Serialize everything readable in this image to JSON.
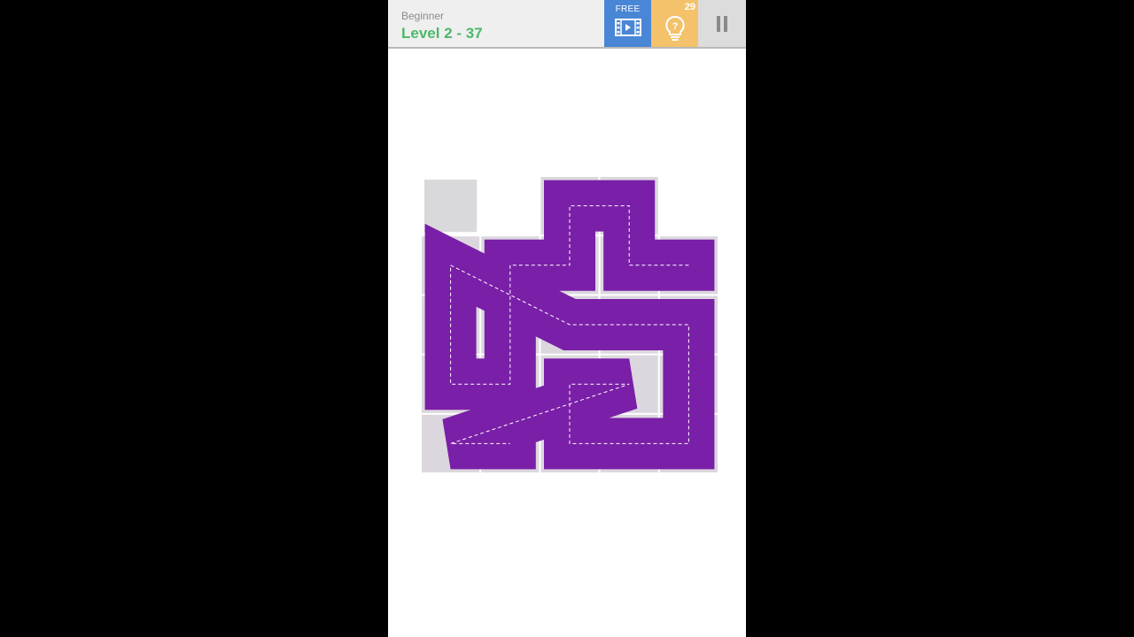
{
  "header": {
    "difficulty": "Beginner",
    "level": "Level 2 - 37",
    "free_label": "FREE",
    "hint_count": "29"
  },
  "icons": {
    "free": "film-icon",
    "hint": "lightbulb-question-icon",
    "pause": "pause-icon"
  },
  "colors": {
    "path": "#7a1fa8",
    "empty_cell": "#d9d9dc",
    "header_bg": "#efefef",
    "level_text": "#4cb869",
    "free_bg": "#4a86d6",
    "hint_bg": "#f3c26a",
    "pause_bg": "#dcdcdc"
  },
  "puzzle": {
    "rows": 5,
    "cols": 5,
    "empty_cells": [
      [
        0,
        0
      ]
    ],
    "path": [
      [
        1,
        4
      ],
      [
        1,
        3
      ],
      [
        0,
        3
      ],
      [
        0,
        2
      ],
      [
        1,
        2
      ],
      [
        1,
        1
      ],
      [
        2,
        1
      ],
      [
        3,
        1
      ],
      [
        3,
        0
      ],
      [
        2,
        0
      ],
      [
        1,
        0
      ],
      [
        2,
        2
      ],
      [
        2,
        3
      ],
      [
        2,
        4
      ],
      [
        3,
        4
      ],
      [
        4,
        4
      ],
      [
        4,
        3
      ],
      [
        4,
        2
      ],
      [
        3,
        2
      ],
      [
        3,
        3
      ],
      [
        4,
        0
      ],
      [
        4,
        1
      ]
    ],
    "path_order": "connected",
    "complete": false
  }
}
